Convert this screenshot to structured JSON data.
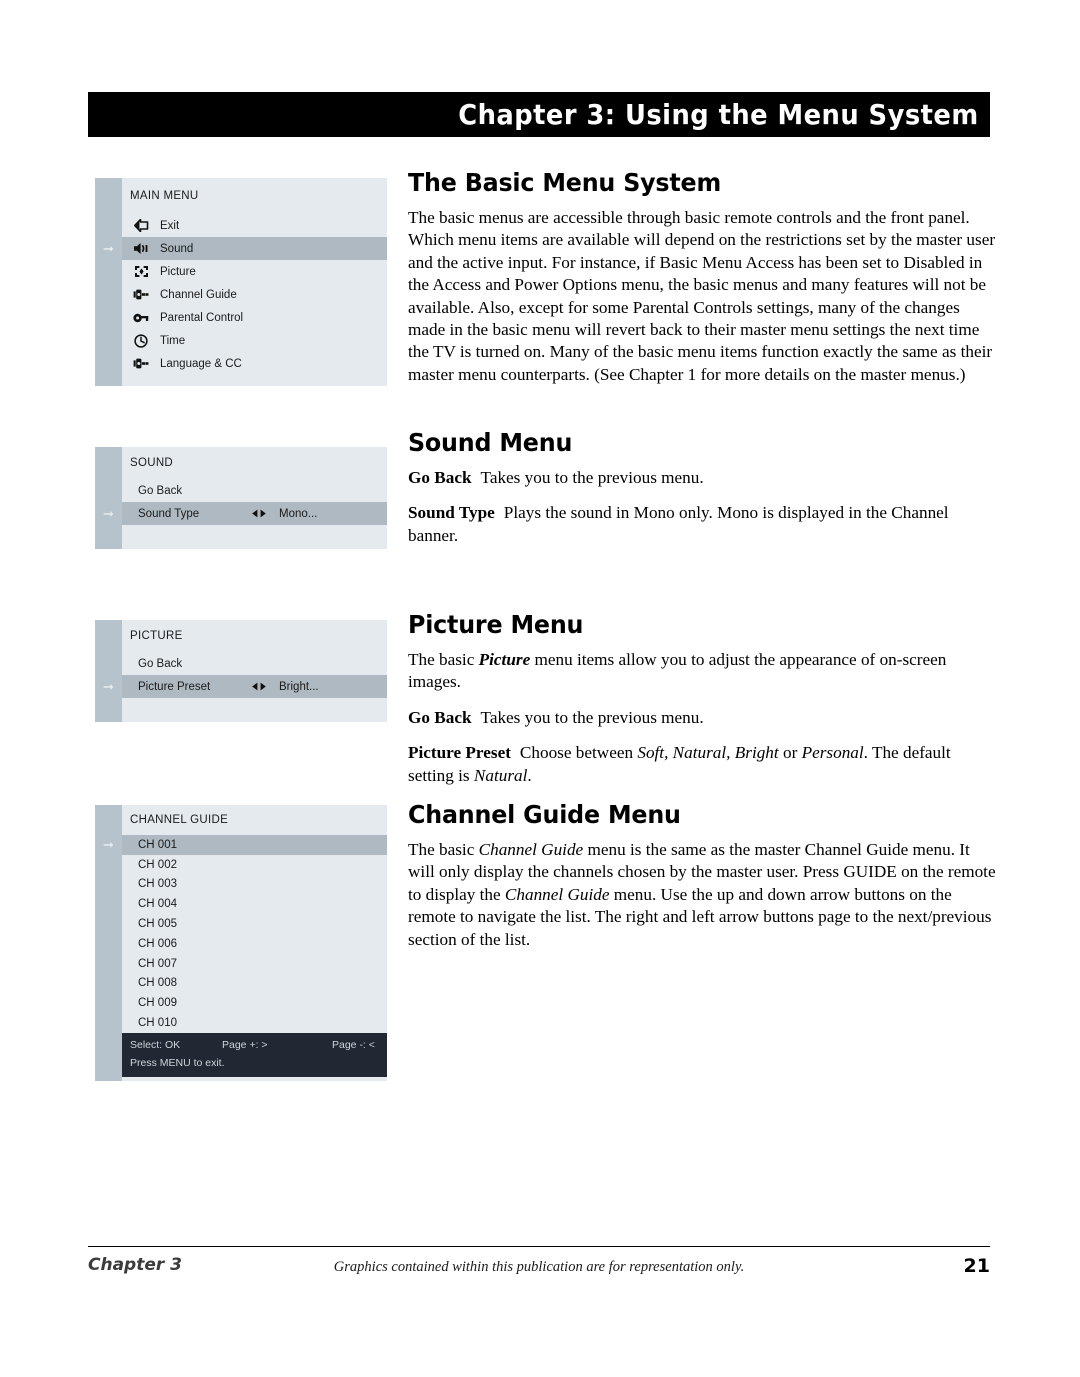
{
  "header": {
    "banner_title": "Chapter 3: Using the Menu System"
  },
  "sections": {
    "basic": {
      "title": "The Basic Menu System",
      "p1_a": "The basic menus are accessible through basic remote controls and the front panel. Which menu items are available will depend on the restrictions set by the master user and the active input. For instance, if Basic Menu Access has been set to Disabled in the Access and Power Options menu, the basic menus and many features will not be available. Also, except for some Parental Controls settings, many of the changes made in the basic menu will revert back to their master menu settings the next time the TV is turned on. Many of the basic menu items function exactly the same as their master menu counterparts. (See Chapter 1 for more details on the master menus.)"
    },
    "sound": {
      "title": "Sound Menu",
      "go_back_term": "Go Back",
      "go_back_desc": "Takes you to the previous menu.",
      "sound_type_term": "Sound Type",
      "sound_type_desc": "Plays the sound in Mono only. Mono is displayed in the Channel banner."
    },
    "picture": {
      "title": "Picture Menu",
      "intro_a": "The basic ",
      "intro_em": "Picture",
      "intro_b": " menu items allow you to adjust the appearance of on-screen images.",
      "go_back_term": "Go Back",
      "go_back_desc": "Takes you to the previous menu.",
      "preset_term": "Picture Preset",
      "preset_a": "Choose between ",
      "preset_options": "Soft, Natural, Bright",
      "preset_b": " or ",
      "preset_personal": "Personal",
      "preset_c": ". The default setting is ",
      "preset_default": "Natural",
      "preset_d": "."
    },
    "guide": {
      "title": "Channel Guide Menu",
      "p_a": "The basic ",
      "p_em1": "Channel Guide",
      "p_b": " menu is the same as the master Channel Guide menu. It will only display the channels chosen by the master user. Press GUIDE on the remote to display the ",
      "p_em2": "Channel Guide",
      "p_c": " menu. Use the up and down arrow buttons on the remote to navigate the list. The right and left arrow buttons page to the next/previous section of the list."
    }
  },
  "tv_panels": {
    "main_menu": {
      "title": "MAIN MENU",
      "items": [
        {
          "label": "Exit",
          "icon": "exit-icon",
          "selected": false
        },
        {
          "label": "Sound",
          "icon": "speaker-icon",
          "selected": true
        },
        {
          "label": "Picture",
          "icon": "picture-icon",
          "selected": false
        },
        {
          "label": "Channel Guide",
          "icon": "plug-icon",
          "selected": false
        },
        {
          "label": "Parental Control",
          "icon": "key-icon",
          "selected": false
        },
        {
          "label": "Time",
          "icon": "clock-icon",
          "selected": false
        },
        {
          "label": "Language & CC",
          "icon": "plug-icon",
          "selected": false
        }
      ]
    },
    "sound": {
      "title": "SOUND",
      "icon": "speaker-icon",
      "items": [
        {
          "label": "Go Back",
          "value": "",
          "selected": false,
          "has_arrows": false
        },
        {
          "label": "Sound Type",
          "value": "Mono...",
          "selected": true,
          "has_arrows": true
        }
      ]
    },
    "picture": {
      "title": "PICTURE",
      "icon": "picture-icon",
      "items": [
        {
          "label": "Go Back",
          "value": "",
          "selected": false,
          "has_arrows": false
        },
        {
          "label": "Picture Preset",
          "value": "Bright...",
          "selected": true,
          "has_arrows": true
        }
      ]
    },
    "channel_guide": {
      "title": "CHANNEL GUIDE",
      "icon": "plug-icon",
      "channels": [
        {
          "label": "CH 001",
          "selected": true
        },
        {
          "label": "CH 002",
          "selected": false
        },
        {
          "label": "CH 003",
          "selected": false
        },
        {
          "label": "CH 004",
          "selected": false
        },
        {
          "label": "CH 005",
          "selected": false
        },
        {
          "label": "CH 006",
          "selected": false
        },
        {
          "label": "CH 007",
          "selected": false
        },
        {
          "label": "CH 008",
          "selected": false
        },
        {
          "label": "CH 009",
          "selected": false
        },
        {
          "label": "CH 010",
          "selected": false
        }
      ],
      "footer": {
        "select": "Select: OK",
        "page_plus": "Page +: >",
        "page_minus": "Page -: <",
        "exit": "Press MENU to exit."
      }
    },
    "selection_arrow": "➞"
  },
  "footer": {
    "chapter": "Chapter 3",
    "note": "Graphics contained within this publication are for representation only.",
    "page": "21"
  },
  "colors": {
    "panel_bg": "#e4eaed",
    "panel_strip": "#b7c3cc",
    "panel_highlight": "#aeb9c2",
    "guide_footer_bg": "#222833",
    "banner_bg": "#000000"
  }
}
